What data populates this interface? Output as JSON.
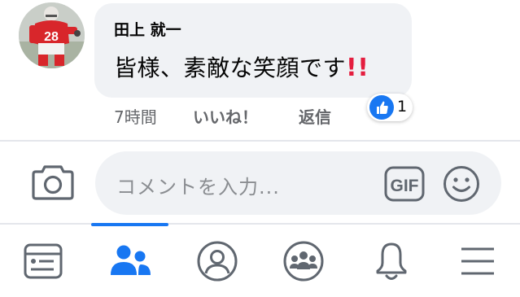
{
  "comment": {
    "author": "田上 就一",
    "text": "皆様、素敵な笑顔です",
    "emphasis": "!!",
    "time": "7時間",
    "like_label": "いいね！",
    "reply_label": "返信",
    "reaction_count": "1",
    "avatar_jersey_number": "28"
  },
  "composer": {
    "placeholder": "コメントを入力...",
    "gif_label": "GIF"
  },
  "nav": {
    "tabs": [
      {
        "icon": "news-feed-icon",
        "active": false
      },
      {
        "icon": "friends-icon",
        "active": true
      },
      {
        "icon": "profile-icon",
        "active": false
      },
      {
        "icon": "groups-icon",
        "active": false
      },
      {
        "icon": "notifications-bell-icon",
        "active": false
      },
      {
        "icon": "menu-icon",
        "active": false
      }
    ]
  },
  "colors": {
    "accent": "#1877f2",
    "bubble": "#f0f2f5",
    "secondary_text": "#65676b",
    "emphasis_red": "#e41e3f"
  }
}
